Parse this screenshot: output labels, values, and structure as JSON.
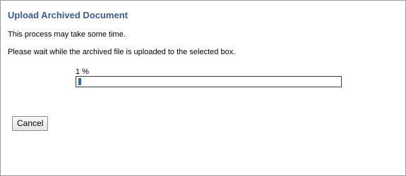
{
  "dialog": {
    "title": "Upload Archived Document",
    "message_line1": "This process may take some time.",
    "message_line2": "Please wait while the archived file is uploaded to the selected box."
  },
  "progress": {
    "label": "1 %",
    "value_percent": 1,
    "bar_color": "#2a6cc2"
  },
  "actions": {
    "cancel_label": "Cancel"
  },
  "colors": {
    "title": "#3b5998",
    "border": "#9c9c9c"
  }
}
